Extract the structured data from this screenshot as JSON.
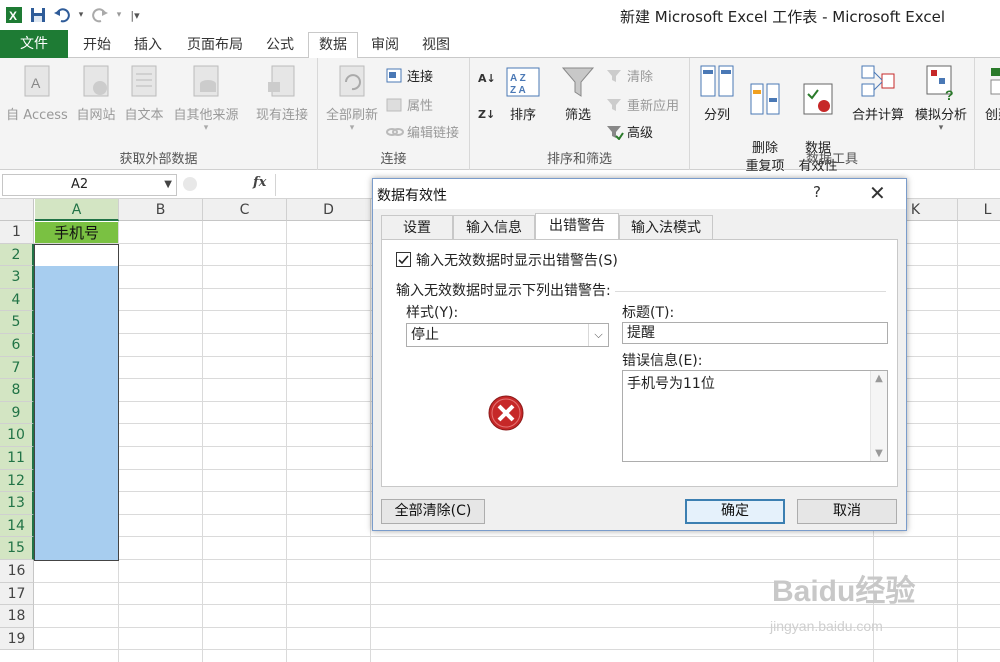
{
  "window": {
    "title": "新建 Microsoft Excel 工作表 - Microsoft Excel"
  },
  "quick_access": {
    "icons": [
      "excel-logo-icon",
      "save-icon",
      "undo-icon",
      "redo-icon",
      "customize-icon"
    ]
  },
  "tabs": [
    "文件",
    "开始",
    "插入",
    "页面布局",
    "公式",
    "数据",
    "审阅",
    "视图"
  ],
  "active_tab": "数据",
  "ribbon": {
    "groups": [
      {
        "label": "获取外部数据",
        "buttons": [
          "自 Access",
          "自网站",
          "自文本",
          "自其他来源",
          "现有连接"
        ]
      },
      {
        "label": "连接",
        "big": "全部刷新",
        "small": [
          "连接",
          "属性",
          "编辑链接"
        ]
      },
      {
        "label": "排序和筛选",
        "sort": "排序",
        "filter": "筛选",
        "small": [
          "清除",
          "重新应用",
          "高级"
        ]
      },
      {
        "label": "数据工具",
        "buttons": [
          "分列",
          "删除\n重复项",
          "数据\n有效性",
          "合并计算",
          "模拟分析"
        ]
      }
    ],
    "extra": "创建"
  },
  "formula_bar": {
    "name_box": "A2",
    "fx": "fx",
    "value": ""
  },
  "grid": {
    "columns": [
      "A",
      "B",
      "C",
      "D",
      "K",
      "L"
    ],
    "rows": [
      "1",
      "2",
      "3",
      "4",
      "5",
      "6",
      "7",
      "8",
      "9",
      "10",
      "11",
      "12",
      "13",
      "14",
      "15",
      "16",
      "17",
      "18",
      "19"
    ],
    "a1": "手机号",
    "selection": "A2:A15"
  },
  "dialog": {
    "title": "数据有效性",
    "help": "?",
    "close": "✕",
    "tabs": [
      "设置",
      "输入信息",
      "出错警告",
      "输入法模式"
    ],
    "active_tab": "出错警告",
    "show_alert_checkbox": {
      "label": "输入无效数据时显示出错警告(S)",
      "checked": true
    },
    "group_label": "输入无效数据时显示下列出错警告:",
    "style_label": "样式(Y):",
    "style_value": "停止",
    "title_label": "标题(T):",
    "title_value": "提醒",
    "message_label": "错误信息(E):",
    "message_value": "手机号为11位",
    "buttons": {
      "clear_all": "全部清除(C)",
      "ok": "确定",
      "cancel": "取消"
    }
  },
  "watermark": {
    "main": "Baidu经验",
    "sub": "jingyan.baidu.com"
  },
  "colors": {
    "file_tab": "#1e7b34",
    "header_cell": "#7ac142",
    "selected_fill": "#a7cdef",
    "stop_icon": "#c62828"
  }
}
